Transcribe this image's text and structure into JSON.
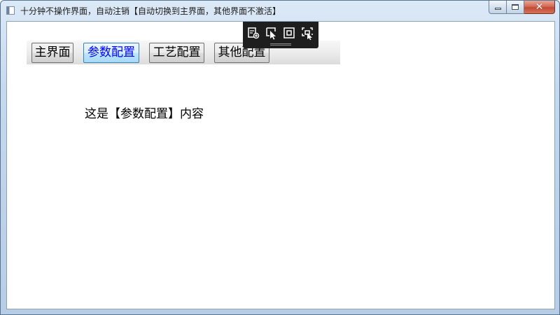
{
  "window": {
    "title": "十分钟不操作界面，自动注销【自动切换到主界面，其他界面不激活】",
    "caption": {
      "minimize_icon": "minimize-icon",
      "maximize_icon": "maximize-icon",
      "close_glyph": "✕"
    }
  },
  "tabs": [
    {
      "label": "主界面",
      "active": false
    },
    {
      "label": "参数配置",
      "active": true
    },
    {
      "label": "工艺配置",
      "active": false
    },
    {
      "label": "其他配置",
      "active": false
    }
  ],
  "content": {
    "text": "这是【参数配置】内容"
  },
  "debug_toolbar": {
    "icons": [
      "live-visual-tree-icon",
      "select-element-icon",
      "display-layout-adorners-icon",
      "track-focused-element-icon"
    ]
  },
  "colors": {
    "active_tab_text": "#0000ff",
    "toolbar_bg": "#1e1e1e"
  }
}
